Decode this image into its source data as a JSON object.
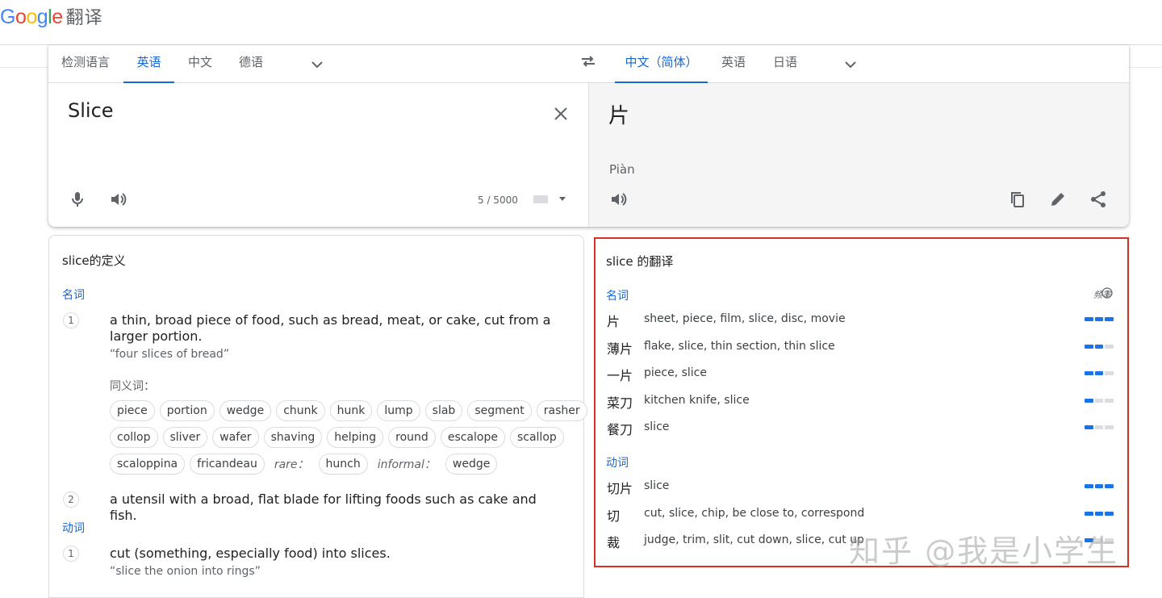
{
  "app": {
    "logo_letters": [
      {
        "ch": "G",
        "color": "#4285F4"
      },
      {
        "ch": "o",
        "color": "#EA4335"
      },
      {
        "ch": "o",
        "color": "#FBBC05"
      },
      {
        "ch": "g",
        "color": "#4285F4"
      },
      {
        "ch": "l",
        "color": "#34A853"
      },
      {
        "ch": "e",
        "color": "#EA4335"
      }
    ],
    "app_name": "翻译"
  },
  "source_langs": [
    "检测语言",
    "英语",
    "中文",
    "德语"
  ],
  "target_langs": [
    "中文（简体）",
    "英语",
    "日语"
  ],
  "source": {
    "text": "Slice",
    "char_count": "5 / 5000"
  },
  "target": {
    "text": "片",
    "transliteration": "Piàn"
  },
  "definitions": {
    "title": "slice的定义",
    "noun_label": "名词",
    "verb_label": "动词",
    "def1": "a thin, broad piece of food, such as bread, meat, or cake, cut from a larger portion.",
    "ex1": "“four slices of bread”",
    "syn_label": "同义词：",
    "syn_row1": [
      "piece",
      "portion",
      "wedge",
      "chunk",
      "hunk",
      "lump",
      "slab",
      "segment",
      "rasher"
    ],
    "syn_row2": [
      "collop",
      "sliver",
      "wafer",
      "shaving",
      "helping",
      "round",
      "escalope",
      "scallop"
    ],
    "syn_row3_a": [
      "scaloppina",
      "fricandeau"
    ],
    "rare_label": "rare：",
    "syn_row3_b": "hunch",
    "informal_label": "informal：",
    "syn_row3_c": "wedge",
    "def2": "a utensil with a broad, flat blade for lifting foods such as cake and fish.",
    "def3": "cut (something, especially food) into slices.",
    "ex3": "“slice the onion into rings”",
    "num1": "1",
    "num2": "2",
    "num3": "1"
  },
  "translations": {
    "title": "slice 的翻译",
    "noun_label": "名词",
    "verb_label": "动词",
    "freq_label": "频率",
    "nouns": [
      {
        "word": "片",
        "syns": "sheet, piece, film, slice, disc, movie",
        "freq": 3
      },
      {
        "word": "薄片",
        "syns": "flake, slice, thin section, thin slice",
        "freq": 2
      },
      {
        "word": "一片",
        "syns": "piece, slice",
        "freq": 2
      },
      {
        "word": "菜刀",
        "syns": "kitchen knife, slice",
        "freq": 1
      },
      {
        "word": "餐刀",
        "syns": "slice",
        "freq": 1
      }
    ],
    "verbs": [
      {
        "word": "切片",
        "syns": "slice",
        "freq": 3
      },
      {
        "word": "切",
        "syns": "cut, slice, chip, be close to, correspond",
        "freq": 3
      },
      {
        "word": "裁",
        "syns": "judge, trim, slit, cut down, slice, cut up",
        "freq": 1
      }
    ]
  },
  "watermark": "知乎 @我是小学生",
  "colors": {
    "accent": "#1967d2",
    "highlight_border": "#d93025"
  }
}
